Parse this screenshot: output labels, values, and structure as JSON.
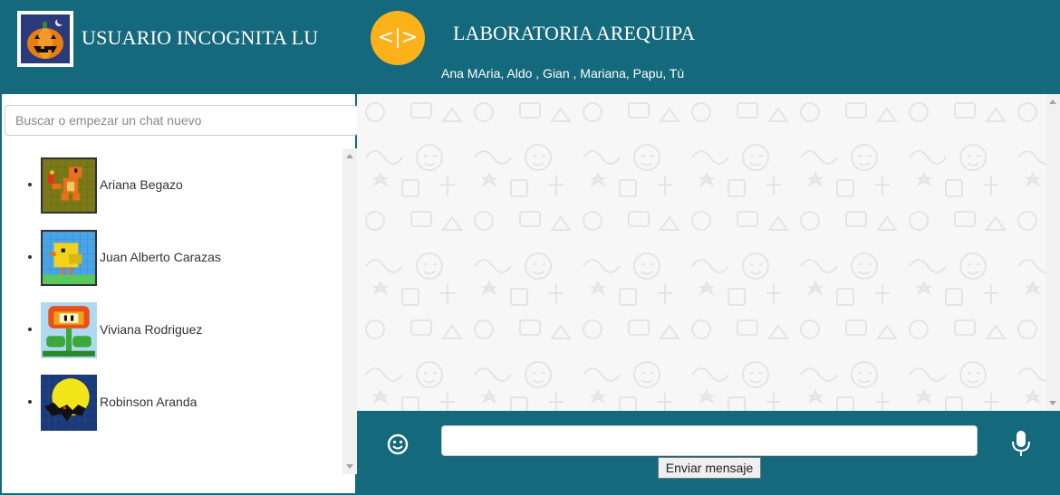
{
  "user": {
    "name": "USUARIO INCOGNITA LU",
    "avatar_icon": "pumpkin-icon"
  },
  "search": {
    "placeholder": "Buscar o empezar un chat nuevo",
    "value": ""
  },
  "contacts": [
    {
      "name": "Ariana Begazo",
      "avatar_icon": "charmander-pixel-icon"
    },
    {
      "name": "Juan Alberto Carazas",
      "avatar_icon": "chick-pixel-icon"
    },
    {
      "name": "Viviana Rodriguez",
      "avatar_icon": "fire-flower-pixel-icon"
    },
    {
      "name": "Robinson Aranda",
      "avatar_icon": "bat-moon-pixel-icon"
    }
  ],
  "chat": {
    "group_icon_text": "<|>",
    "group_name": "LABORATORIA AREQUIPA",
    "members": "Ana MAria, Aldo , Gian , Mariana, Papu, Tú"
  },
  "composer": {
    "input_value": "",
    "send_label": "Enviar mensaje",
    "emoji_icon": "smiley-icon",
    "mic_icon": "microphone-icon"
  },
  "colors": {
    "header": "#15697d",
    "group_icon_bg": "#fbb11a",
    "chat_bg": "#f7f7f7"
  }
}
